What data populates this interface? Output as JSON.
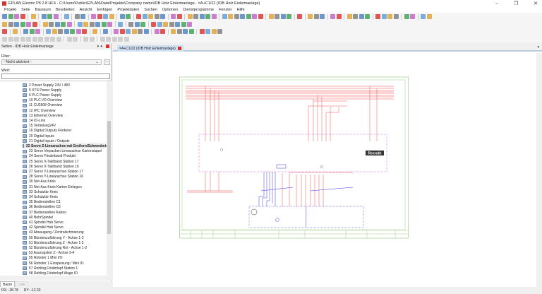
{
  "window": {
    "title": "EPLAN Electric P8 2.8 HF4 - C:\\Users\\Public\\EPLAN\\Data\\Projekte\\Company name\\IDB Holz Einleimanlage - =A+C1/22 (IDB Holz Einleimanlage)",
    "minimize": "–",
    "restore": "❐",
    "close": "✕"
  },
  "menu": [
    "Projekt",
    "Seite",
    "Bauraum",
    "Bearbeiten",
    "Ansicht",
    "Einfügen",
    "Projektdaten",
    "Suchen",
    "Optionen",
    "Dienstprogramme",
    "Fenster",
    "Hilfe"
  ],
  "toolbar_rows": [
    [
      "new-icon",
      "open-icon",
      "save-icon",
      "print-icon",
      "|",
      "wrench-icon",
      "|",
      "cut-icon",
      "copy-icon",
      "paste-icon",
      "|",
      "delete-icon",
      "|",
      "fill-icon",
      "format-icon",
      "|",
      "undo-icon",
      "redo-icon",
      "redo2-icon",
      "redo3-icon",
      "|",
      "page-icon",
      "page2-icon",
      "|",
      "refresh-icon",
      "zoom-window-icon",
      "zoom-in-icon",
      "zoom-out-icon",
      "zoom-fit-icon",
      "|",
      "back-icon",
      "forward-icon",
      "|",
      "net-icon",
      "net2-icon",
      "net3-icon",
      "net4-icon",
      "net5-icon",
      "|",
      "grid-icon",
      "snap-icon",
      "ortho-icon",
      "jump-icon",
      "jump2-icon",
      "jump3-icon",
      "jump4-icon",
      "|",
      "rect-sel-icon",
      "layer-icon",
      "layer2-icon",
      "layer3-icon",
      "|",
      "terminal-icon",
      "|",
      "connect-icon",
      "connect2-icon",
      "connect3-icon",
      "|",
      "angle-icon",
      "angle2-icon",
      "|",
      "corner-tl-icon",
      "corner-tr-icon",
      "corner-bl-icon",
      "corner-br-icon",
      "|",
      "t-down-icon",
      "t-up-icon",
      "t-right-icon",
      "t-left-icon",
      "|",
      "cross-icon",
      "cross2-icon",
      "|",
      "break-icon",
      "diag-icon"
    ],
    [
      "select-icon",
      "page-new-icon",
      "page-prop-icon",
      "page-macro-icon",
      "page-sync-icon",
      "page-copy-icon",
      "|",
      "line-icon",
      "polyline-icon",
      "arc-icon",
      "rectangle-icon",
      "frame-icon",
      "|",
      "circle-icon",
      "circle2-icon",
      "arc2-icon",
      "arc3-icon",
      "ellipse-icon",
      "ellipse2-icon",
      "|",
      "spline-icon",
      "|",
      "text-icon",
      "image-icon",
      "link-icon",
      "|",
      "dim-icon",
      "dim2-icon",
      "dim3-icon",
      "dim4-icon",
      "dim5-icon",
      "dim6-icon",
      "dim7-icon"
    ],
    [
      "macro-icon",
      "|",
      "device-icon",
      "|",
      "plc-icon",
      "plc2-icon",
      "plc3-icon",
      "|",
      "terminal-strip-icon",
      "cable-icon",
      "cable2-icon",
      "cable3-icon",
      "cable4-icon",
      "cable5-icon",
      "wire-icon",
      "|",
      "blank-icon",
      "|",
      "pointer-icon",
      "|",
      "symbol-icon",
      "symbol2-icon",
      "box-icon",
      "box2-icon",
      "box3-icon",
      "box4-icon",
      "|",
      "tag-icon",
      "tag2-icon",
      "|",
      "view-icon",
      "view2-icon",
      "view3-icon",
      "view4-icon",
      "|",
      "connect5-icon",
      "connect6-icon",
      "corner5-icon",
      "corner6-icon"
    ],
    [
      "g1-icon",
      "g2-icon",
      "g3-icon",
      "g4-icon",
      "g5-icon",
      "g6-icon",
      "g7-icon",
      "g8-icon",
      "g9-icon",
      "g10-icon",
      "|",
      "g11-icon",
      "g12-icon",
      "|",
      "g13-icon",
      "g14-icon",
      "|",
      "g15-icon",
      "g16-icon",
      "g17-icon",
      "g18-icon",
      "g19-icon"
    ]
  ],
  "panel": {
    "title": "Seiten - IDB Holz Einleimanlage",
    "pin": "▾ ✦",
    "filter_label": "Filter:",
    "filter_value": "- Nicht aktiviert -",
    "filter_button": "...",
    "value_label": "Wert:",
    "value": "",
    "tree": [
      "2 Power Supply 24V / 48V",
      "5 XTS Power Supply",
      "6 PLC Power Supply",
      "10 PLC I/O Overview",
      "11 CU2508 Overview",
      "12 IPC Overview",
      "13 Ethernet Overview",
      "14 IO-Link",
      "15 Verteilung24V",
      "16 Digital Outputs Förderer",
      "20 Digital Inputs",
      "21 Digital Inputs / Outputs",
      "22 Servo Z-Linearachse mit Greifern/Schwenkeinheit",
      "23 Servo Verpacken Linearachse Kartonstapel",
      "24 Servo Förderband Produkt",
      "25 Servo X-Taktband Station 17",
      "26 Servo X-Taktband Station 16",
      "27 Servo Y-Linearachse Station 17",
      "28 Servo Y-Linearachse Station 16",
      "30 Not-Aus Kreis",
      "31 Not-Aus Kreis Karton Einlegen",
      "33 Schutztür Kreis",
      "34 Schutztür Kreis",
      "35 Bedienstellen C1",
      "36 Bedienstellen C6",
      "37 Bedienstellen Karton",
      "40 BohrSpindel",
      "41 Spindel Hub Servo",
      "42 Spindel Hub Servo",
      "43 Absaugung / Zentralschmierung",
      "50 Bürstenzuführung Y - Achse 1-2",
      "51 Bürstenzuführung Z - Achse 1-2",
      "52 Bürstenzuführung Rot - Achse 1-2",
      "53 Auszugstert Z - Achse 3-4",
      "55 Roboter 1 Mini I/O",
      "56 Roboter 1 Einspeisung / Mini IO",
      "57 Rohling Förderlopf Station 1",
      "58 Rohling Förderlopf Wago IO"
    ],
    "selected_index": 12,
    "tabs": [
      "Baum",
      "Liste"
    ]
  },
  "document": {
    "tab_label": "=A+C1/22 (IDB Holz Einleimanlage)",
    "tab_dropdown": "▾",
    "brand_label": "Rexroth"
  },
  "status": {
    "rx": "RX: -28.78",
    "ry": "RY: -12.20"
  },
  "colors": {
    "accent": "#d9302c",
    "wire_red": "#f05050",
    "wire_blue": "#3a3ae0",
    "plc_box": "#e040e0",
    "frame": "#8fbf6f"
  }
}
